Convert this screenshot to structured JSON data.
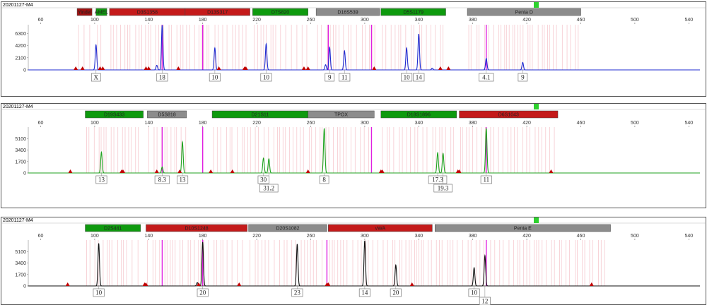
{
  "colors": {
    "blue_dye": "#1f2bd0",
    "green_dye": "#1fa21f",
    "black_dye": "#111111",
    "red_dye": "#c00000",
    "marker_green": "#0e9a0e",
    "marker_red": "#c41a1a",
    "marker_gray": "#8c8c8c",
    "marker_darkred": "#a01010",
    "status_green": "#2ed12e",
    "bin_magenta": "#e020e0",
    "bin_pink": "#f6c9cf"
  },
  "chart_data": [
    {
      "type": "line",
      "panel_label": "20201127-M4",
      "dye": "blue",
      "x_ticks": [
        60,
        100,
        140,
        180,
        220,
        260,
        300,
        340,
        380,
        420,
        460,
        500,
        540
      ],
      "y_ticks": [
        0,
        2100,
        4200,
        6300
      ],
      "xlim": [
        45,
        555
      ],
      "ylim": [
        0,
        7800
      ],
      "markers": [
        {
          "name": "Yindel",
          "start": 87,
          "end": 98,
          "color": "darkred"
        },
        {
          "name": "AMEL",
          "start": 101,
          "end": 109,
          "color": "green"
        },
        {
          "name": "D3S1358",
          "start": 111,
          "end": 167,
          "color": "red"
        },
        {
          "name": "D13S317",
          "start": 167,
          "end": 215,
          "color": "red"
        },
        {
          "name": "D7S820",
          "start": 217,
          "end": 258,
          "color": "green"
        },
        {
          "name": "D16S539",
          "start": 264,
          "end": 311,
          "color": "gray"
        },
        {
          "name": "D5S1179",
          "start": 312,
          "end": 360,
          "color": "green"
        },
        {
          "name": "Penta D",
          "start": 376,
          "end": 460,
          "color": "gray"
        }
      ],
      "peaks": [
        {
          "x": 101,
          "y": 4300,
          "label": "X"
        },
        {
          "x": 150,
          "y": 7700,
          "label": "18"
        },
        {
          "x": 146,
          "y": 800,
          "label": ""
        },
        {
          "x": 189,
          "y": 3800,
          "label": "10"
        },
        {
          "x": 227,
          "y": 4500,
          "label": "10"
        },
        {
          "x": 274,
          "y": 3900,
          "label": "9"
        },
        {
          "x": 271,
          "y": 900,
          "label": ""
        },
        {
          "x": 285,
          "y": 3300,
          "label": "11"
        },
        {
          "x": 331,
          "y": 3800,
          "label": "10"
        },
        {
          "x": 340,
          "y": 6200,
          "label": "14"
        },
        {
          "x": 350,
          "y": 300,
          "label": ""
        },
        {
          "x": 390,
          "y": 2000,
          "label": "4.1"
        },
        {
          "x": 417,
          "y": 1300,
          "label": "9"
        }
      ],
      "artifacts": [
        86,
        91,
        104,
        106,
        138,
        140,
        162,
        192,
        211,
        212,
        255,
        258,
        307,
        356,
        362
      ]
    },
    {
      "type": "line",
      "panel_label": "20201127-M4",
      "dye": "green",
      "x_ticks": [
        60,
        100,
        140,
        180,
        220,
        260,
        300,
        340,
        380,
        420,
        460,
        500,
        540
      ],
      "y_ticks": [
        0,
        1700,
        3400,
        5100
      ],
      "xlim": [
        45,
        555
      ],
      "ylim": [
        0,
        6800
      ],
      "markers": [
        {
          "name": "D19S433",
          "start": 93,
          "end": 136,
          "color": "green"
        },
        {
          "name": "D5S818",
          "start": 139,
          "end": 168,
          "color": "gray"
        },
        {
          "name": "D21S11",
          "start": 187,
          "end": 258,
          "color": "green"
        },
        {
          "name": "TPOX",
          "start": 258,
          "end": 307,
          "color": "gray"
        },
        {
          "name": "D18S1896",
          "start": 312,
          "end": 368,
          "color": "green"
        },
        {
          "name": "D6S1043",
          "start": 370,
          "end": 443,
          "color": "red"
        }
      ],
      "peaks": [
        {
          "x": 105,
          "y": 3100,
          "label": "13"
        },
        {
          "x": 150,
          "y": 900,
          "label": "8.3"
        },
        {
          "x": 165,
          "y": 4600,
          "label": "13"
        },
        {
          "x": 225,
          "y": 2200,
          "label": "30"
        },
        {
          "x": 229,
          "y": 2100,
          "label": "31.2"
        },
        {
          "x": 270,
          "y": 6600,
          "label": "8"
        },
        {
          "x": 354,
          "y": 3000,
          "label": "17.3"
        },
        {
          "x": 358,
          "y": 2900,
          "label": "19.3"
        },
        {
          "x": 390,
          "y": 6600,
          "label": "11"
        }
      ],
      "artifacts": [
        82,
        120,
        121,
        146,
        163,
        186,
        202,
        258,
        312,
        313,
        369,
        370,
        438
      ]
    },
    {
      "type": "line",
      "panel_label": "20201127-M4",
      "dye": "black",
      "x_ticks": [
        60,
        100,
        140,
        180,
        220,
        260,
        300,
        340,
        380,
        420,
        460,
        500,
        540
      ],
      "y_ticks": [
        0,
        1700,
        3400,
        5100
      ],
      "xlim": [
        45,
        555
      ],
      "ylim": [
        0,
        6800
      ],
      "markers": [
        {
          "name": "D2S441",
          "start": 93,
          "end": 134,
          "color": "green"
        },
        {
          "name": "D10S1248",
          "start": 138,
          "end": 213,
          "color": "red"
        },
        {
          "name": "D20S1082",
          "start": 214,
          "end": 272,
          "color": "gray"
        },
        {
          "name": "vWA",
          "start": 273,
          "end": 350,
          "color": "red"
        },
        {
          "name": "Penta E",
          "start": 352,
          "end": 482,
          "color": "gray"
        }
      ],
      "peaks": [
        {
          "x": 103,
          "y": 6300,
          "label": "10"
        },
        {
          "x": 180,
          "y": 6500,
          "label": "20"
        },
        {
          "x": 176,
          "y": 500,
          "label": ""
        },
        {
          "x": 250,
          "y": 6200,
          "label": "23"
        },
        {
          "x": 300,
          "y": 6700,
          "label": "14"
        },
        {
          "x": 323,
          "y": 3100,
          "label": "20"
        },
        {
          "x": 381,
          "y": 2700,
          "label": "10"
        },
        {
          "x": 389,
          "y": 4500,
          "label": "12"
        }
      ],
      "artifacts": [
        80,
        137,
        138,
        177,
        207,
        272,
        273,
        335,
        468
      ]
    }
  ]
}
